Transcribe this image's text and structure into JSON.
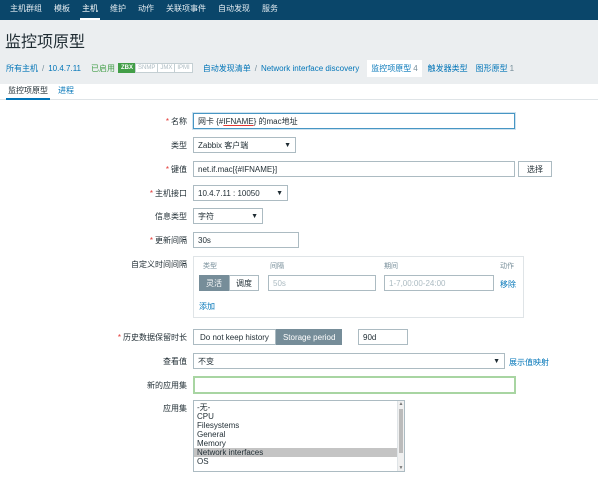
{
  "topnav": [
    "主机群组",
    "模板",
    "主机",
    "维护",
    "动作",
    "关联项事件",
    "自动发现",
    "服务"
  ],
  "topnav_active": 2,
  "page_title": "监控项原型",
  "hostnav": {
    "all_hosts": "所有主机",
    "host": "10.4.7.11",
    "status": "已启用",
    "availability": [
      "ZBX",
      "SNMP",
      "JMX",
      "IPMI"
    ],
    "discovery_list": "自动发现清单",
    "discovery_rule": "Network interface discovery",
    "item_prototypes": "监控项原型",
    "item_prototypes_count": "4",
    "trigger_prototypes": "触发器类型",
    "graph_prototypes": "图形原型",
    "graph_prototypes_count": "1"
  },
  "tabs": [
    "监控项原型",
    "进程"
  ],
  "form": {
    "name_label": "名称",
    "name_parts": [
      "网卡 {#",
      "IFNAME",
      "} 的mac地址"
    ],
    "type_label": "类型",
    "type_value": "Zabbix 客户端",
    "key_label": "键值",
    "key_value": "net.if.mac[{#IFNAME}]",
    "select_button": "选择",
    "interface_label": "主机接口",
    "interface_value": "10.4.7.11 : 10050",
    "info_type_label": "信息类型",
    "info_type_value": "字符",
    "interval_label": "更新间隔",
    "interval_value": "30s",
    "custom_label": "自定义时间间隔",
    "custom_headers": {
      "type": "类型",
      "interval": "间隔",
      "period": "期间",
      "action": "动作"
    },
    "custom_type_options": [
      "灵活",
      "调度"
    ],
    "custom_interval_placeholder": "50s",
    "custom_period_placeholder": "1-7,00:00-24:00",
    "remove_link": "移除",
    "add_link": "添加",
    "history_label": "历史数据保留时长",
    "history_options": [
      "Do not keep history",
      "Storage period"
    ],
    "history_value": "90d",
    "show_value_label": "查看值",
    "show_value_value": "不变",
    "show_value_mapping": "展示值映射",
    "new_app_label": "新的应用集",
    "new_app_value": "",
    "apps_label": "应用集",
    "apps": [
      "-无-",
      "CPU",
      "Filesystems",
      "General",
      "Memory",
      "Network interfaces",
      "OS"
    ],
    "apps_selected": 5
  }
}
